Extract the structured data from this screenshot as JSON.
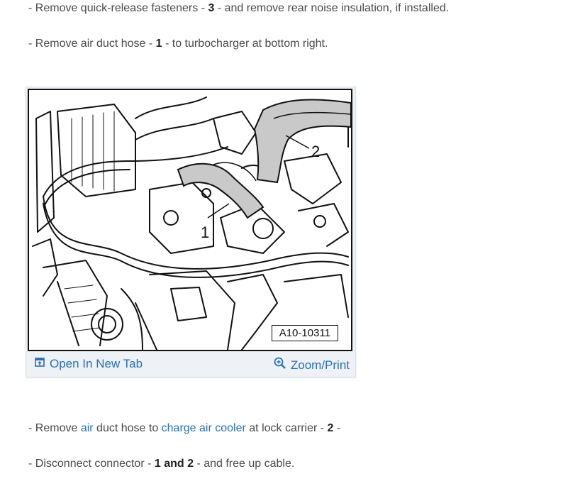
{
  "steps": [
    {
      "dash": "- ",
      "text_a": "Remove quick-release fasteners - ",
      "bold": "3",
      "text_b": " - and remove rear noise insulation, if installed."
    },
    {
      "dash": "- ",
      "text_a": "Remove air duct hose - ",
      "bold": "1",
      "text_b": " - to turbocharger at bottom right."
    },
    {
      "dash": "- ",
      "text_a": "Remove ",
      "link1": "air",
      "text_b": " duct hose to ",
      "link2": "charge air cooler",
      "text_c": " at lock carrier - ",
      "bold": "2",
      "text_d": " -"
    },
    {
      "dash": "- ",
      "text_a": "Disconnect connector - ",
      "bold": "1 and 2",
      "text_b": " - and free up cable."
    }
  ],
  "figure": {
    "labels": [
      "1",
      "2"
    ],
    "reference": "A10-10311",
    "open_label": "Open In New Tab",
    "zoom_label": "Zoom/Print",
    "open_icon": "open-new-tab-icon",
    "zoom_icon": "magnifier-icon",
    "link_color": "#2a6fb5"
  }
}
